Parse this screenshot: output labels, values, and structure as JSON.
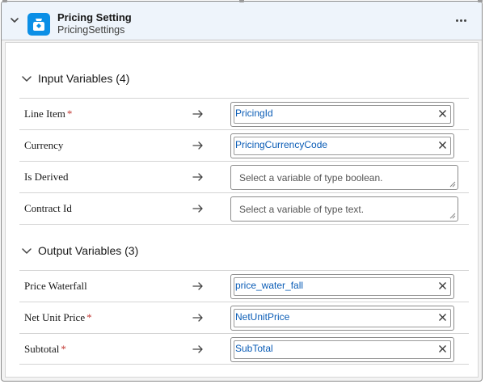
{
  "header": {
    "title": "Pricing Setting",
    "subtitle": "PricingSettings"
  },
  "input_section": {
    "title": "Input Variables (4)",
    "rows": [
      {
        "label": "Line Item",
        "required": "*",
        "value": "PricingId",
        "placeholder": ""
      },
      {
        "label": "Currency",
        "required": "",
        "value": "PricingCurrencyCode",
        "placeholder": ""
      },
      {
        "label": "Is Derived",
        "required": "",
        "value": "",
        "placeholder": "Select a variable of type boolean."
      },
      {
        "label": "Contract Id",
        "required": "",
        "value": "",
        "placeholder": "Select a variable of type text."
      }
    ]
  },
  "output_section": {
    "title": "Output Variables (3)",
    "rows": [
      {
        "label": "Price Waterfall",
        "required": "",
        "value": "price_water_fall",
        "placeholder": ""
      },
      {
        "label": "Net Unit Price",
        "required": "*",
        "value": "NetUnitPrice",
        "placeholder": ""
      },
      {
        "label": "Subtotal",
        "required": "*",
        "value": "SubTotal",
        "placeholder": ""
      }
    ]
  },
  "colors": {
    "accent": "#0b8fe6",
    "link_value": "#0a5cb6",
    "required": "#c23934",
    "header_bg": "#eef4fb"
  },
  "icons": {
    "app": "pricing-bag-icon",
    "collapse": "chevron-down-icon",
    "more": "more-actions-icon",
    "arrow": "arrow-right-icon",
    "clear": "close-icon"
  }
}
